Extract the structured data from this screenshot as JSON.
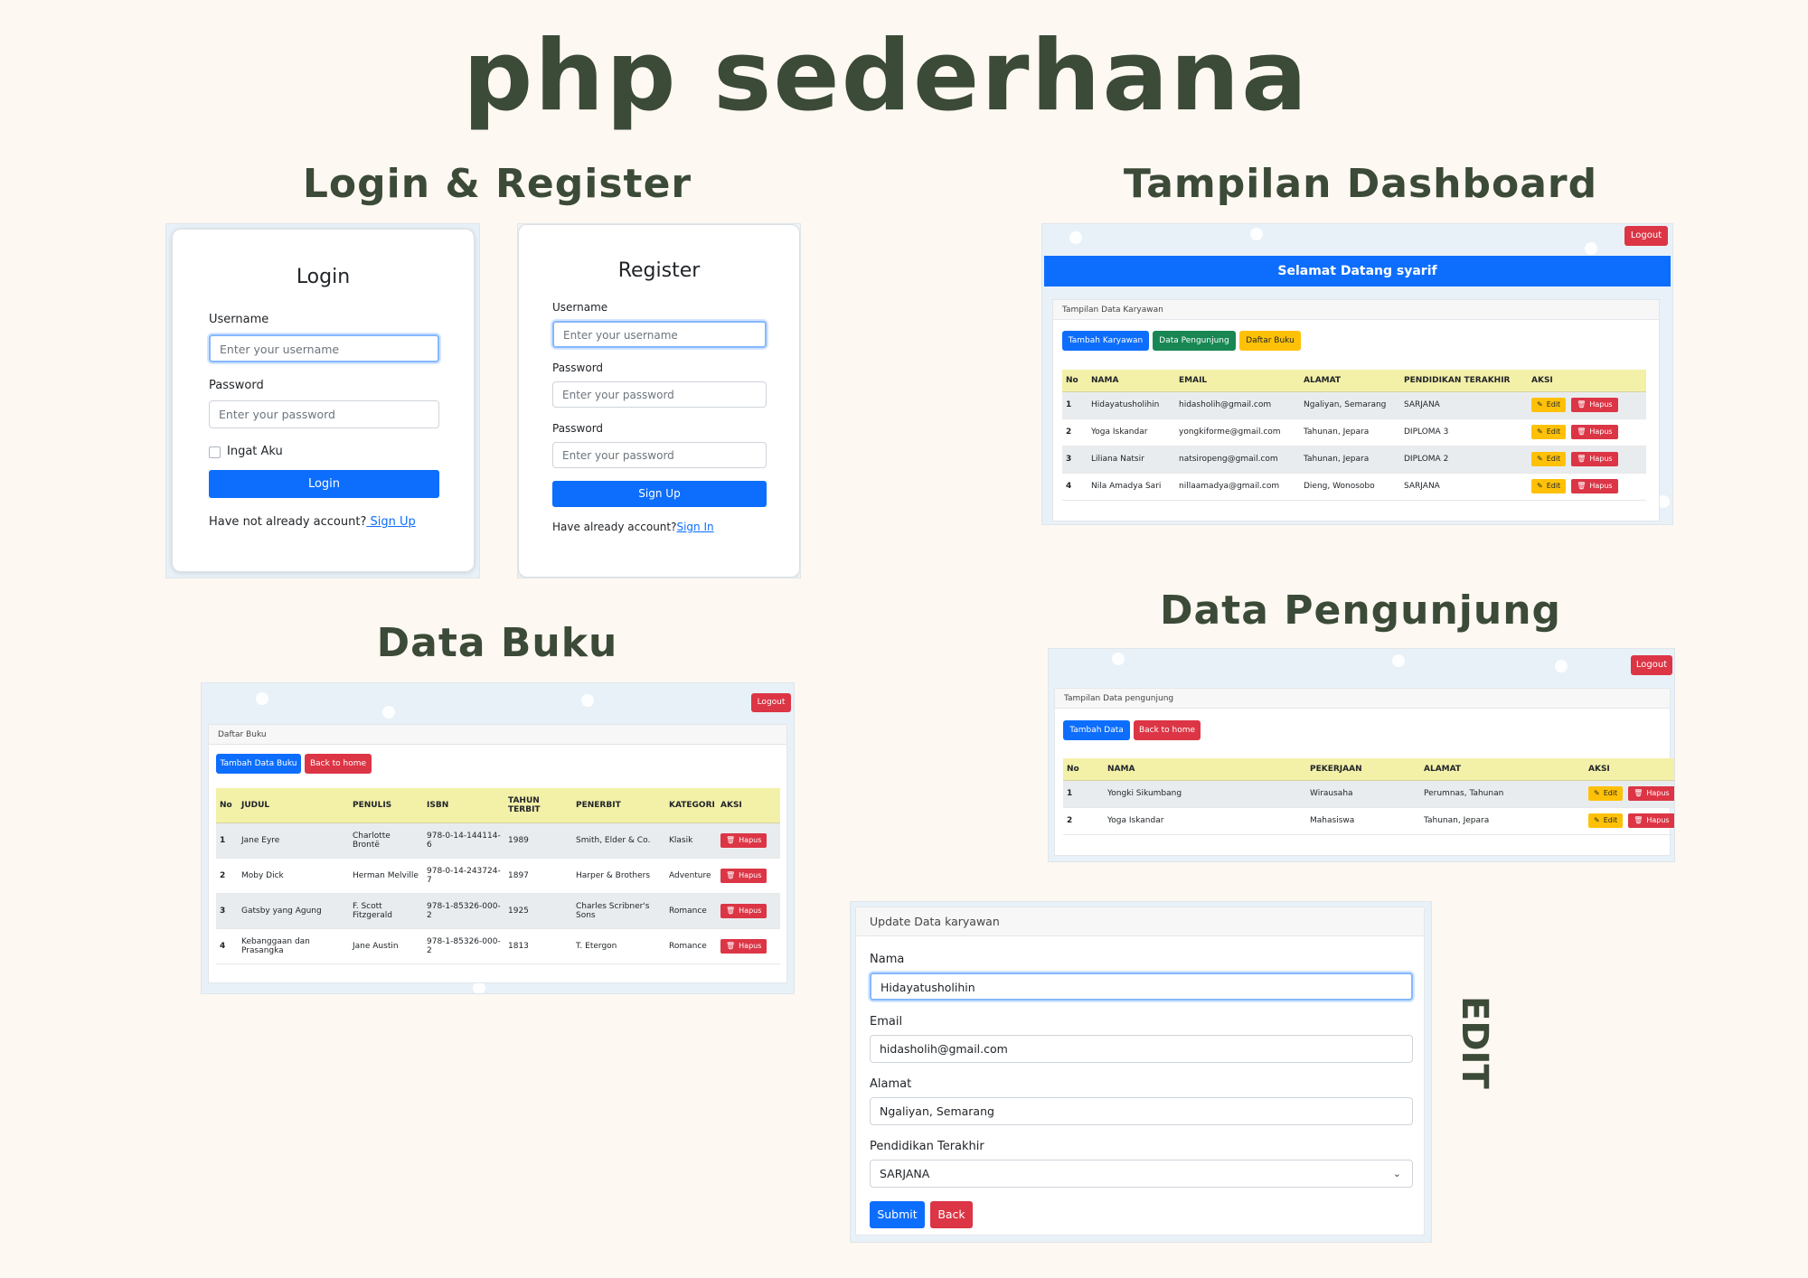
{
  "poster_title": "php sederhana",
  "sections": {
    "login_register": "Login & Register",
    "dashboard": "Tampilan Dashboard",
    "data_buku": "Data Buku",
    "data_pengunjung": "Data Pengunjung",
    "edit": "EDIT"
  },
  "login": {
    "title": "Login",
    "username_label": "Username",
    "username_placeholder": "Enter your username",
    "password_label": "Password",
    "password_placeholder": "Enter your password",
    "remember_label": "Ingat Aku",
    "submit_label": "Login",
    "footer_text": "Have not already account?",
    "footer_link": " Sign Up"
  },
  "register": {
    "title": "Register",
    "username_label": "Username",
    "username_placeholder": "Enter your username",
    "password_label": "Password",
    "password_placeholder": "Enter your password",
    "password2_label": "Password",
    "password2_placeholder": "Enter your password",
    "submit_label": "Sign Up",
    "footer_text": "Have already account?",
    "footer_link": "Sign In"
  },
  "dashboard": {
    "logout": "Logout",
    "welcome": "Selamat Datang syarif",
    "panel_title": "Tampilan Data Karyawan",
    "btn_tambah": "Tambah Karyawan",
    "btn_pengunjung": "Data Pengunjung",
    "btn_buku": "Daftar Buku",
    "columns": [
      "No",
      "NAMA",
      "EMAIL",
      "ALAMAT",
      "PENDIDIKAN TERAKHIR",
      "AKSI"
    ],
    "edit_label": "Edit",
    "hapus_label": "Hapus",
    "rows": [
      {
        "no": "1",
        "nama": "Hidayatusholihin",
        "email": "hidasholih@gmail.com",
        "alamat": "Ngaliyan, Semarang",
        "pendidikan": "SARJANA"
      },
      {
        "no": "2",
        "nama": "Yoga Iskandar",
        "email": "yongkiforme@gmail.com",
        "alamat": "Tahunan, Jepara",
        "pendidikan": "DIPLOMA 3"
      },
      {
        "no": "3",
        "nama": "Liliana Natsir",
        "email": "natsiropeng@gmail.com",
        "alamat": "Tahunan, Jepara",
        "pendidikan": "DIPLOMA 2"
      },
      {
        "no": "4",
        "nama": "Nila Amadya Sari",
        "email": "nillaamadya@gmail.com",
        "alamat": "Dieng, Wonosobo",
        "pendidikan": "SARJANA"
      }
    ]
  },
  "buku": {
    "logout": "Logout",
    "panel_title": "Daftar Buku",
    "btn_tambah": "Tambah Data Buku",
    "btn_back": "Back to home",
    "columns": [
      "No",
      "JUDUL",
      "PENULIS",
      "ISBN",
      "TAHUN TERBIT",
      "PENERBIT",
      "KATEGORI",
      "AKSI"
    ],
    "hapus_label": "Hapus",
    "rows": [
      {
        "no": "1",
        "judul": "Jane Eyre",
        "penulis": "Charlotte Brontë",
        "isbn": "978-0-14-144114-6",
        "tahun": "1989",
        "penerbit": "Smith, Elder & Co.",
        "kategori": "Klasik"
      },
      {
        "no": "2",
        "judul": "Moby Dick",
        "penulis": "Herman Melville",
        "isbn": "978-0-14-243724-7",
        "tahun": "1897",
        "penerbit": "Harper & Brothers",
        "kategori": "Adventure"
      },
      {
        "no": "3",
        "judul": "Gatsby yang Agung",
        "penulis": "F. Scott Fitzgerald",
        "isbn": "978-1-85326-000-2",
        "tahun": "1925",
        "penerbit": "Charles Scribner's Sons",
        "kategori": "Romance"
      },
      {
        "no": "4",
        "judul": "Kebanggaan dan Prasangka",
        "penulis": "Jane Austin",
        "isbn": "978-1-85326-000-2",
        "tahun": "1813",
        "penerbit": "T. Etergon",
        "kategori": "Romance"
      }
    ]
  },
  "pengunjung": {
    "logout": "Logout",
    "panel_title": "Tampilan Data pengunjung",
    "btn_tambah": "Tambah Data",
    "btn_back": "Back to home",
    "columns": [
      "No",
      "NAMA",
      "PEKERJAAN",
      "ALAMAT",
      "AKSI"
    ],
    "edit_label": "Edit",
    "hapus_label": "Hapus",
    "rows": [
      {
        "no": "1",
        "nama": "Yongki Sikumbang",
        "pekerjaan": "Wirausaha",
        "alamat": "Perumnas, Tahunan"
      },
      {
        "no": "2",
        "nama": "Yoga Iskandar",
        "pekerjaan": "Mahasiswa",
        "alamat": "Tahunan, Jepara"
      }
    ]
  },
  "edit_form": {
    "panel_title": "Update Data karyawan",
    "nama_label": "Nama",
    "nama_value": "Hidayatusholihin",
    "email_label": "Email",
    "email_value": "hidasholih@gmail.com",
    "alamat_label": "Alamat",
    "alamat_value": "Ngaliyan, Semarang",
    "pendidikan_label": "Pendidikan Terakhir",
    "pendidikan_value": "SARJANA",
    "submit_label": "Submit",
    "back_label": "Back"
  },
  "colors": {
    "title": "#3c4a38",
    "primary": "#0d6efd",
    "success": "#198754",
    "warning": "#ffc107",
    "danger": "#dc3545",
    "table_header": "#f3f0a8",
    "background": "#fdf8f2"
  }
}
